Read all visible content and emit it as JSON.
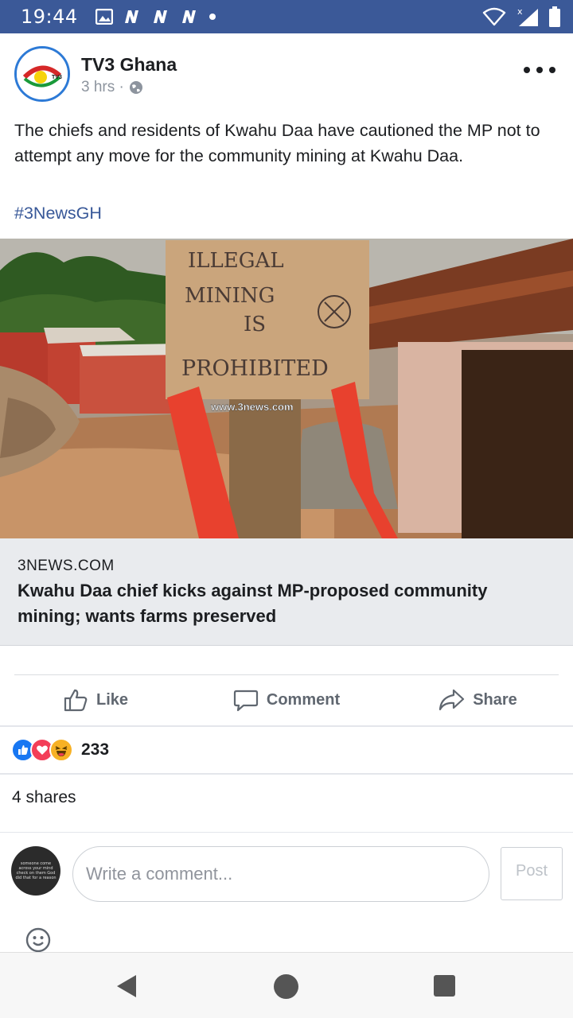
{
  "status_bar": {
    "time": "19:44",
    "notification_icons": [
      "image-icon",
      "n-icon",
      "n-icon",
      "n-icon",
      "dot-icon"
    ],
    "right_icons": [
      "wifi-icon",
      "signal-icon",
      "battery-icon"
    ]
  },
  "post": {
    "page_name": "TV3 Ghana",
    "timestamp": "3 hrs ·",
    "body": "The chiefs and residents of Kwahu Daa have cautioned the MP not to attempt any move for the community mining at Kwahu Daa.",
    "hashtag": "#3NewsGH",
    "avatar_logo_text": "TV3"
  },
  "link_preview": {
    "image_sign_lines": [
      "ILLEGAL",
      "MINING",
      "IS",
      "PROHIBITED"
    ],
    "image_watermark": "www.3news.com",
    "domain": "3NEWS.COM",
    "title": "Kwahu Daa chief kicks against MP-proposed community mining; wants farms preserved"
  },
  "actions": {
    "like": "Like",
    "comment": "Comment",
    "share": "Share"
  },
  "reactions": {
    "icons": [
      "like-reaction-icon",
      "love-reaction-icon",
      "haha-reaction-icon"
    ],
    "count": "233"
  },
  "shares": "4 shares",
  "composer": {
    "avatar_text": "someone come across your mind check on them God did that for a reason",
    "placeholder": "Write a comment...",
    "post_label": "Post"
  },
  "colors": {
    "status_bar": "#3b5998",
    "link": "#385898",
    "like_blue": "#1877f2",
    "love_red": "#f33e58",
    "haha_yellow": "#f7b125"
  }
}
